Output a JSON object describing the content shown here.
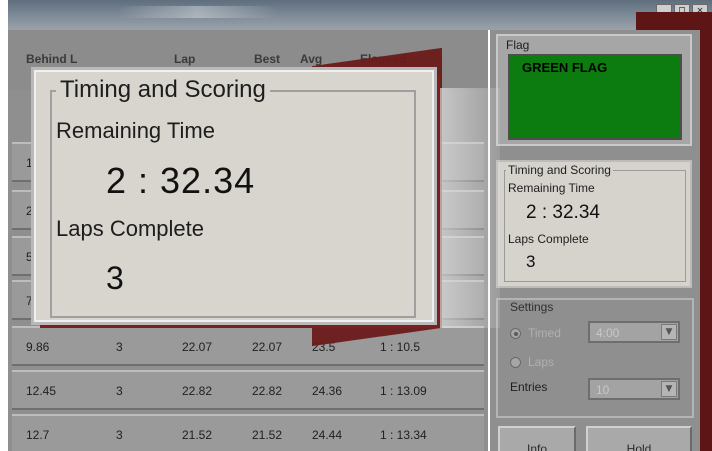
{
  "window": {
    "buttons": [
      "_",
      "□",
      "✕"
    ]
  },
  "table": {
    "headers": [
      "Behind L",
      "Lap",
      "Best",
      "Avg",
      "Elapsed"
    ],
    "partial_rows": [
      {
        "behind": "1"
      },
      {
        "behind": "2"
      },
      {
        "behind": "5"
      },
      {
        "behind": "7"
      }
    ],
    "rows": [
      {
        "behind": "9.86",
        "lap": "3",
        "last": "22.07",
        "best": "22.07",
        "avg": "23.5",
        "elapsed": "1 : 10.5"
      },
      {
        "behind": "12.45",
        "lap": "3",
        "last": "22.82",
        "best": "22.82",
        "avg": "24.36",
        "elapsed": "1 : 13.09"
      },
      {
        "behind": "12.7",
        "lap": "3",
        "last": "21.52",
        "best": "21.52",
        "avg": "24.44",
        "elapsed": "1 : 13.34"
      }
    ]
  },
  "zoom": {
    "legend": "Timing and Scoring",
    "remaining_label": "Remaining Time",
    "remaining_value": "2 : 32.34",
    "laps_label": "Laps Complete",
    "laps_value": "3"
  },
  "flag": {
    "legend": "Flag",
    "status": "GREEN FLAG",
    "color": "#0d7c10"
  },
  "timing": {
    "legend": "Timing and Scoring",
    "remaining_label": "Remaining Time",
    "remaining_value": "2 : 32.34",
    "laps_label": "Laps Complete",
    "laps_value": "3"
  },
  "settings": {
    "legend": "Settings",
    "timed_label": "Timed",
    "timed_value": "4:00",
    "laps_label": "Laps",
    "entries_label": "Entries",
    "entries_value": "10"
  },
  "buttons": {
    "info": "Info",
    "other": "Hold"
  }
}
